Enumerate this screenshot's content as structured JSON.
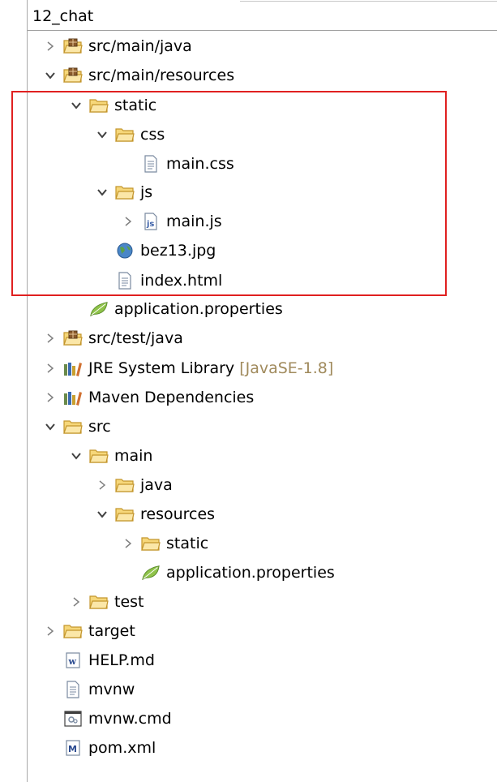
{
  "project": {
    "name": "12_chat"
  },
  "tree": [
    {
      "label": "src/main/java",
      "icon": "package-folder-icon",
      "toggle": "collapsed"
    },
    {
      "label": "src/main/resources",
      "icon": "package-folder-icon",
      "toggle": "expanded"
    },
    {
      "label": "static",
      "icon": "folder-icon",
      "toggle": "expanded"
    },
    {
      "label": "css",
      "icon": "folder-icon",
      "toggle": "expanded"
    },
    {
      "label": "main.css",
      "icon": "text-file-icon",
      "toggle": "none"
    },
    {
      "label": "js",
      "icon": "folder-icon",
      "toggle": "expanded"
    },
    {
      "label": "main.js",
      "icon": "js-file-icon",
      "toggle": "collapsed"
    },
    {
      "label": "bez13.jpg",
      "icon": "globe-icon",
      "toggle": "none"
    },
    {
      "label": "index.html",
      "icon": "text-file-icon",
      "toggle": "none"
    },
    {
      "label": "application.properties",
      "icon": "spring-leaf-icon",
      "toggle": "none"
    },
    {
      "label": "src/test/java",
      "icon": "package-folder-icon",
      "toggle": "collapsed"
    },
    {
      "label": "JRE System Library",
      "decoration": "[JavaSE-1.8]",
      "icon": "library-icon",
      "toggle": "collapsed"
    },
    {
      "label": "Maven Dependencies",
      "icon": "library-icon",
      "toggle": "collapsed"
    },
    {
      "label": "src",
      "icon": "folder-icon",
      "toggle": "expanded"
    },
    {
      "label": "main",
      "icon": "folder-icon",
      "toggle": "expanded"
    },
    {
      "label": "java",
      "icon": "folder-icon",
      "toggle": "collapsed"
    },
    {
      "label": "resources",
      "icon": "folder-icon",
      "toggle": "expanded"
    },
    {
      "label": "static",
      "icon": "folder-icon",
      "toggle": "collapsed"
    },
    {
      "label": "application.properties",
      "icon": "spring-leaf-icon",
      "toggle": "none"
    },
    {
      "label": "test",
      "icon": "folder-icon",
      "toggle": "collapsed"
    },
    {
      "label": "target",
      "icon": "folder-icon",
      "toggle": "collapsed"
    },
    {
      "label": "HELP.md",
      "icon": "word-file-icon",
      "toggle": "none"
    },
    {
      "label": "mvnw",
      "icon": "text-file-icon",
      "toggle": "none"
    },
    {
      "label": "mvnw.cmd",
      "icon": "cmd-file-icon",
      "toggle": "none"
    },
    {
      "label": "pom.xml",
      "icon": "maven-file-icon",
      "toggle": "none"
    }
  ],
  "colors": {
    "folder": "#f2c55c",
    "highlight": "#e02020",
    "decoration": "#a08a5c"
  }
}
